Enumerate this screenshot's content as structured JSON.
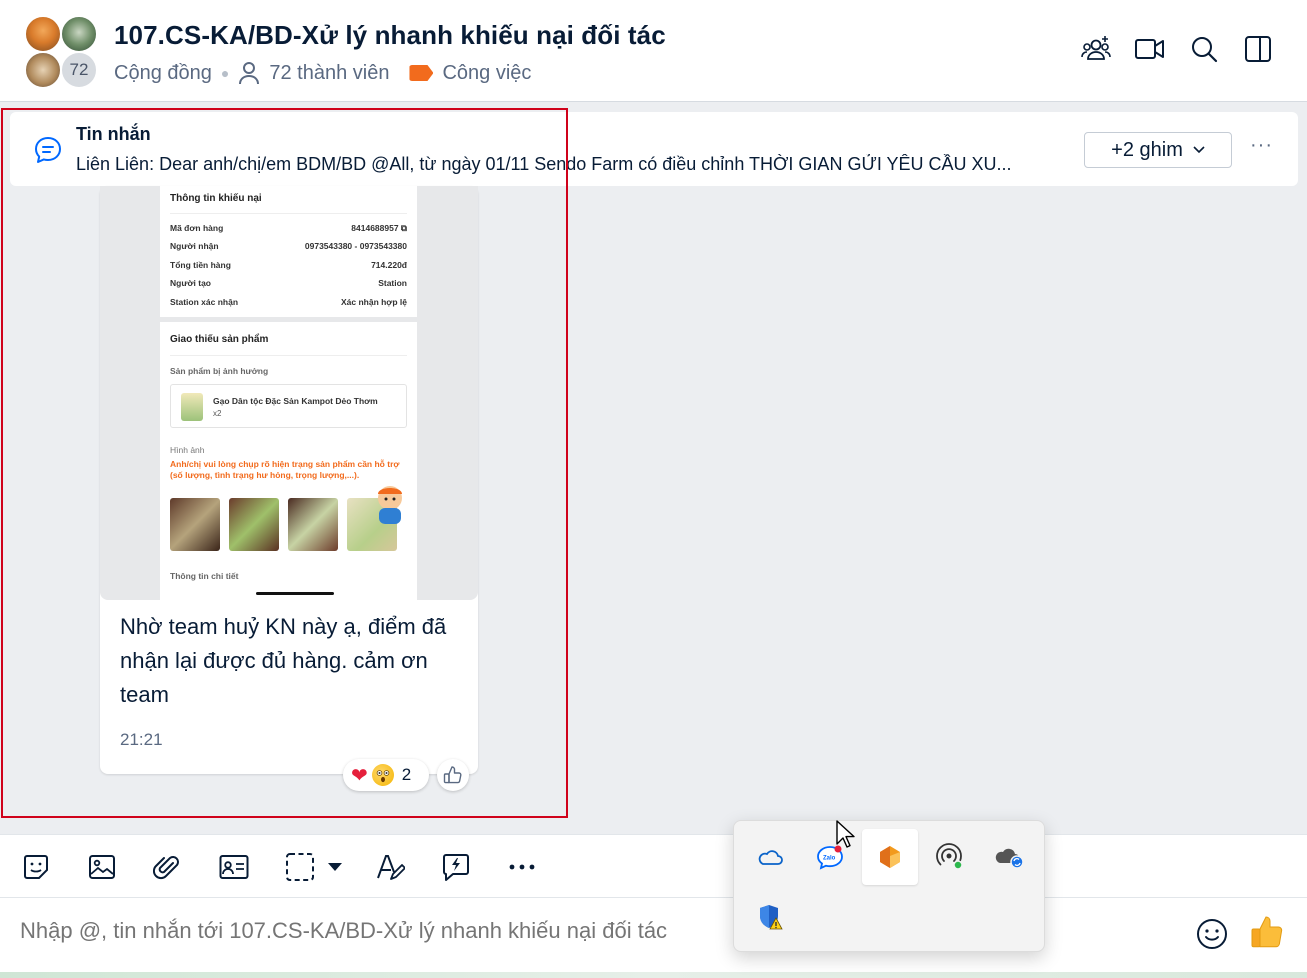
{
  "header": {
    "title": "107.CS-KA/BD-Xử lý nhanh khiếu nại đối tác",
    "type": "Cộng đồng",
    "members": "72 thành viên",
    "label": "Công việc",
    "avatar_count": "72",
    "label_color": "#f26b1d"
  },
  "pinned": {
    "title": "Tin nhắn",
    "text": "Liên Liên: Dear anh/chị/em BDM/BD @All, từ ngày 01/11 Sendo Farm có điều chỉnh THỜI GIAN GỬI YÊU CẦU XU...",
    "button": "+2 ghim",
    "more": "···"
  },
  "screenshot": {
    "card1_title": "Thông tin khiếu nại",
    "rows": [
      {
        "label": "Mã đơn hàng",
        "value": "8414688957 ⧉"
      },
      {
        "label": "Người nhận",
        "value": "0973543380 - 0973543380"
      },
      {
        "label": "Tổng tiền hàng",
        "value": "714.220đ"
      },
      {
        "label": "Người tạo",
        "value": "Station"
      },
      {
        "label": "Station xác nhận",
        "value": "Xác nhận hợp lệ"
      }
    ],
    "card2_title": "Giao thiếu sản phẩm",
    "affected_label": "Sản phẩm bị ảnh hưởng",
    "product_name": "Gạo Dân tộc Đặc Sản Kampot Dẻo Thơm",
    "product_qty": "x2",
    "image_label": "Hình ảnh",
    "warning": "Anh/chị vui lòng chụp rõ hiện trạng sản phẩm cần hỗ trợ (số lượng, tình trạng hư hỏng, trọng lượng,...).",
    "detail_label": "Thông tin chi tiết"
  },
  "message": {
    "text": "Nhờ team huỷ KN này ạ, điểm đã nhận lại được đủ hàng. cảm ơn team",
    "time": "21:21",
    "reaction_count": "2"
  },
  "composer": {
    "placeholder": "Nhập @, tin nhắn tới 107.CS-KA/BD-Xử lý nhanh khiếu nại đối tác"
  },
  "colors": {
    "accent": "#0068ff",
    "highlight_frame": "#d0021b",
    "warning_text": "#f26b1d"
  },
  "tray_icons": [
    "onedrive-icon",
    "zalo-icon",
    "app-orange-icon",
    "hotspot-icon",
    "cloud-sync-icon",
    "windows-security-icon"
  ]
}
